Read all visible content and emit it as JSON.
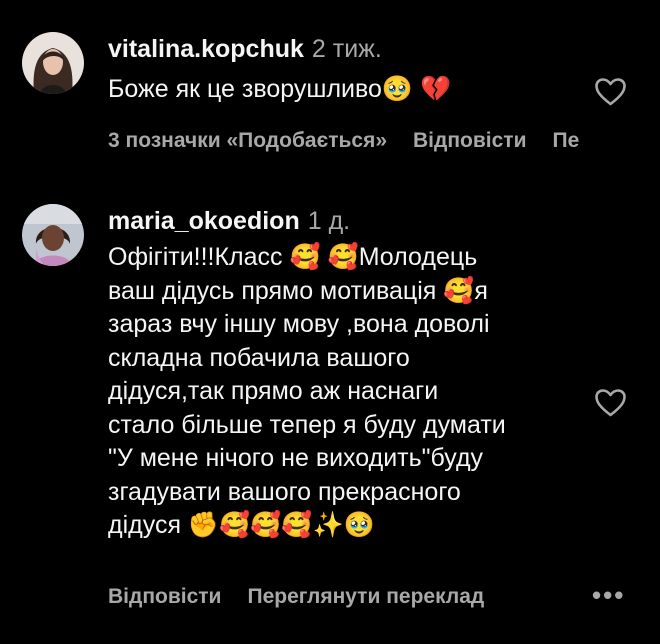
{
  "comments": [
    {
      "username": "vitalina.kopchuk",
      "time": "2 тиж.",
      "text": "Боже як це зворушливо🥹 💔",
      "likes_label": "3 позначки «Подобається»",
      "reply_label": "Відповісти",
      "extra_label": "Пе"
    },
    {
      "username": "maria_okoedion",
      "time": "1 д.",
      "text": "Офігіти!!!Класс 🥰 🥰Молодець\nваш дідусь прямо мотивація 🥰я\nзараз вчу іншу мову ,вона доволі\nскладна побачила вашого\nдідуся,так прямо аж наснаги\nстало більше тепер я буду думати\n\"У мене нічого не виходить\"буду\nзгадувати вашого прекрасного\nдідуся ✊🥰🥰🥰✨🥹",
      "reply_label": "Відповісти",
      "translate_label": "Переглянути переклад",
      "more_label": "•••"
    }
  ],
  "colors": {
    "background": "#000000",
    "primary_text": "#f5f5f5",
    "secondary_text": "#a8a8a8"
  },
  "icons": {
    "like": "heart-outline-icon",
    "more": "more-options-icon"
  }
}
